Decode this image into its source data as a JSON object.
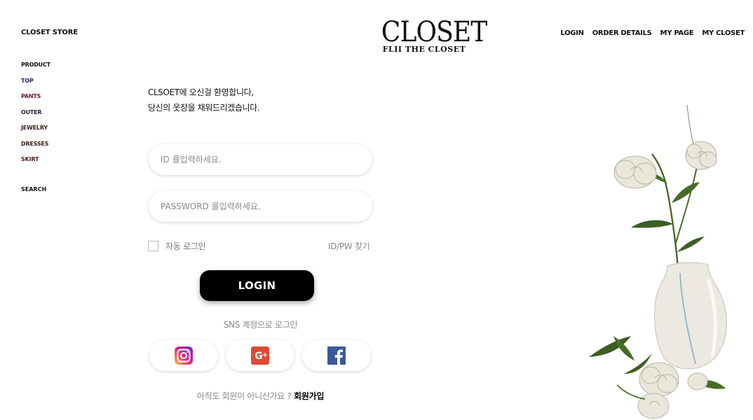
{
  "sidebar": {
    "store_name": "CLOSET STORE",
    "items": [
      {
        "label": "PRODUCT",
        "color": "#111111"
      },
      {
        "label": "TOP",
        "color": "#1f2a57"
      },
      {
        "label": "PANTS",
        "color": "#6b1444"
      },
      {
        "label": "OUTER",
        "color": "#2a1a3a"
      },
      {
        "label": "JEWELRY",
        "color": "#3a1c14"
      },
      {
        "label": "DRESSES",
        "color": "#3a1c14"
      },
      {
        "label": "SKIRT",
        "color": "#5a1a1a"
      }
    ],
    "search": "SEARCH"
  },
  "logo": {
    "main": "CLOSET",
    "sub": "FLII THE CLOSET"
  },
  "topnav": {
    "items": [
      "LOGIN",
      "ORDER DETAILS",
      "MY PAGE",
      "MY CLOSET"
    ]
  },
  "welcome": {
    "line1": "CLSOET에 오신걸 환영합니다,",
    "line2": "당신의 옷장을 채워드리겠습니다."
  },
  "form": {
    "id_placeholder": "ID 를입력하세요.",
    "pw_placeholder": "PASSWORD 를입력하세요.",
    "auto_login_label": "자동 로그인",
    "auto_login_checked": false,
    "find_link": "ID/PW 찾기",
    "login_button": "LOGIN"
  },
  "sns": {
    "label": "SNS 계정으로 로그인",
    "buttons": [
      {
        "icon": "instagram-icon"
      },
      {
        "icon": "google-plus-icon"
      },
      {
        "icon": "facebook-icon"
      }
    ]
  },
  "signup": {
    "prompt": "아직도 회원이 아니신가요 ?",
    "link": "회원가입"
  },
  "colors": {
    "accent": "#000000",
    "placeholder": "#888888",
    "instagram": "#c13584",
    "google_plus": "#dd4b39",
    "facebook": "#3b5998"
  }
}
